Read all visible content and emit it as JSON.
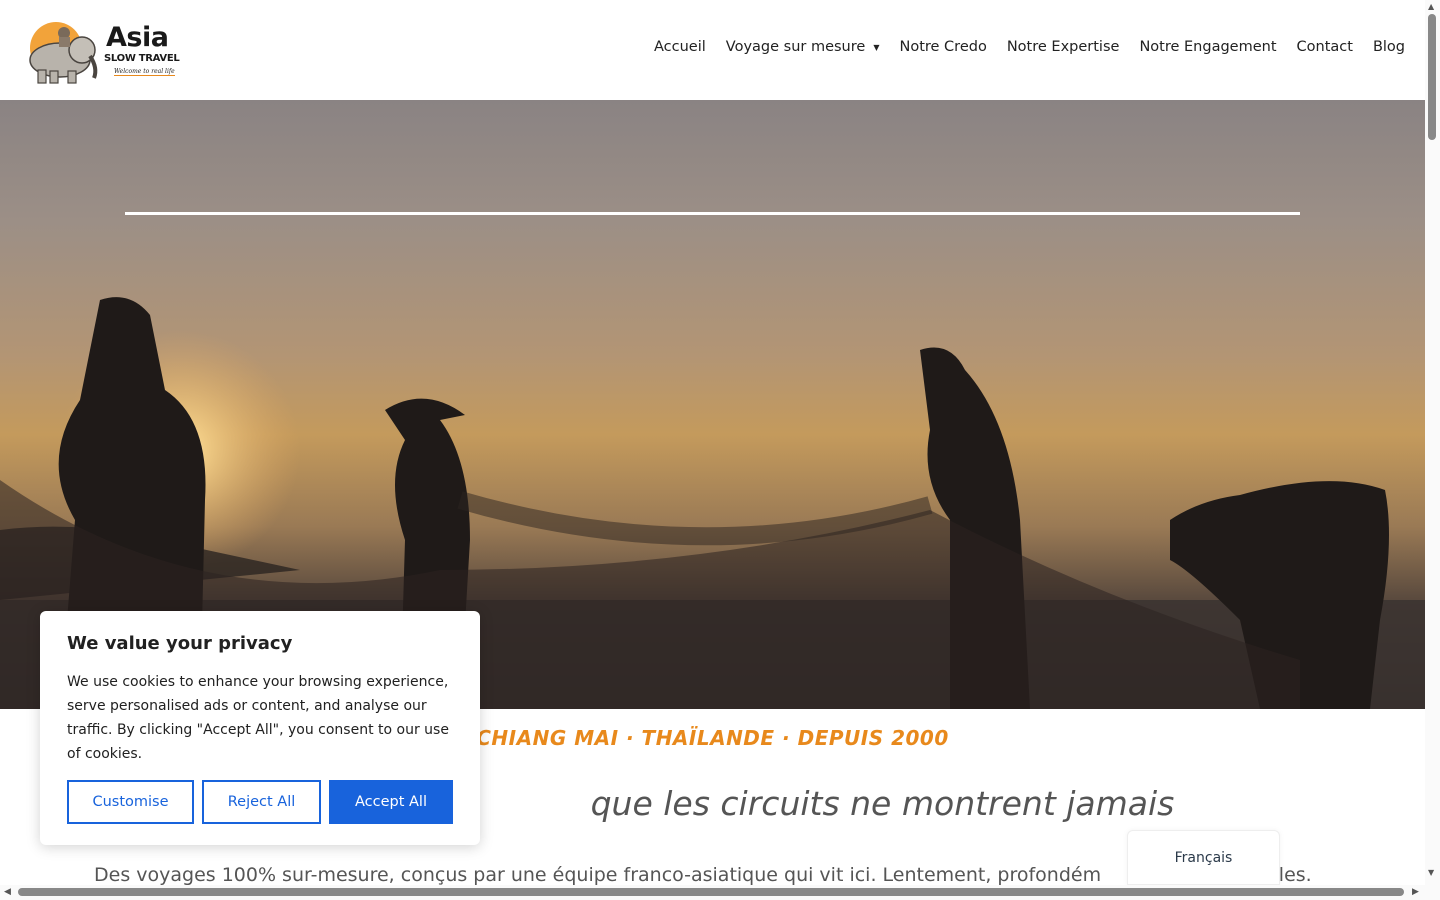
{
  "logo": {
    "main": "Asia",
    "sub": "SLOW TRAVEL",
    "tagline": "Welcome to real life"
  },
  "nav": {
    "items": [
      {
        "label": "Accueil"
      },
      {
        "label": "Voyage sur mesure"
      },
      {
        "label": "Notre Credo"
      },
      {
        "label": "Notre Expertise"
      },
      {
        "label": "Notre Engagement"
      },
      {
        "label": "Contact"
      },
      {
        "label": "Blog"
      }
    ]
  },
  "content": {
    "kicker": "CHIANG MAI · THAÏLANDE · DEPUIS 2000",
    "headline_visible": "que les circuits ne montrent jamais",
    "lead_left": "Des voyages 100% sur-mesure, conçus par une équipe franco-asiatique qui vit ici. Lentement, profondém",
    "lead_right": "oules."
  },
  "cookie": {
    "title": "We value your privacy",
    "text": "We use cookies to enhance your browsing experience, serve personalised ads or content, and analyse our traffic. By clicking \"Accept All\", you consent to our use of cookies.",
    "customise": "Customise",
    "reject": "Reject All",
    "accept": "Accept All"
  },
  "language": {
    "current": "Français"
  },
  "colors": {
    "accent": "#e8891c",
    "primary_button": "#1863dc"
  }
}
